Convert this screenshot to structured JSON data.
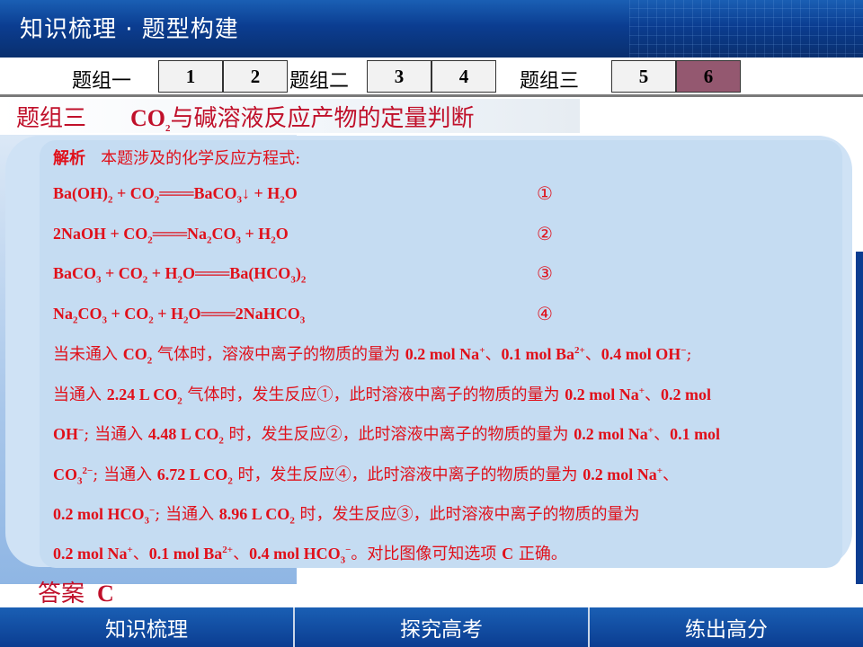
{
  "header": {
    "title": "知识梳理 · 题型构建"
  },
  "nav": {
    "groups": [
      {
        "label": "题组一",
        "items": [
          "1",
          "2"
        ]
      },
      {
        "label": "题组二",
        "items": [
          "3",
          "4"
        ]
      },
      {
        "label": "题组三",
        "items": [
          "5",
          "6"
        ]
      }
    ],
    "active": "6"
  },
  "section": {
    "label": "题组三",
    "title_pre": "CO",
    "title_sub": "2",
    "title_post": "与碱溶液反应产物的定量判断"
  },
  "analysis": {
    "label": "解析",
    "intro": "本题涉及的化学反应方程式:",
    "markers": [
      "①",
      "②",
      "③",
      "④"
    ]
  },
  "answer": {
    "label": "答案",
    "value": "C"
  },
  "footer": {
    "tabs": [
      "知识梳理",
      "探究高考",
      "练出高分"
    ]
  },
  "colors": {
    "accent": "#e0101a",
    "header": "#0b3d91",
    "active_tab": "#945870"
  }
}
